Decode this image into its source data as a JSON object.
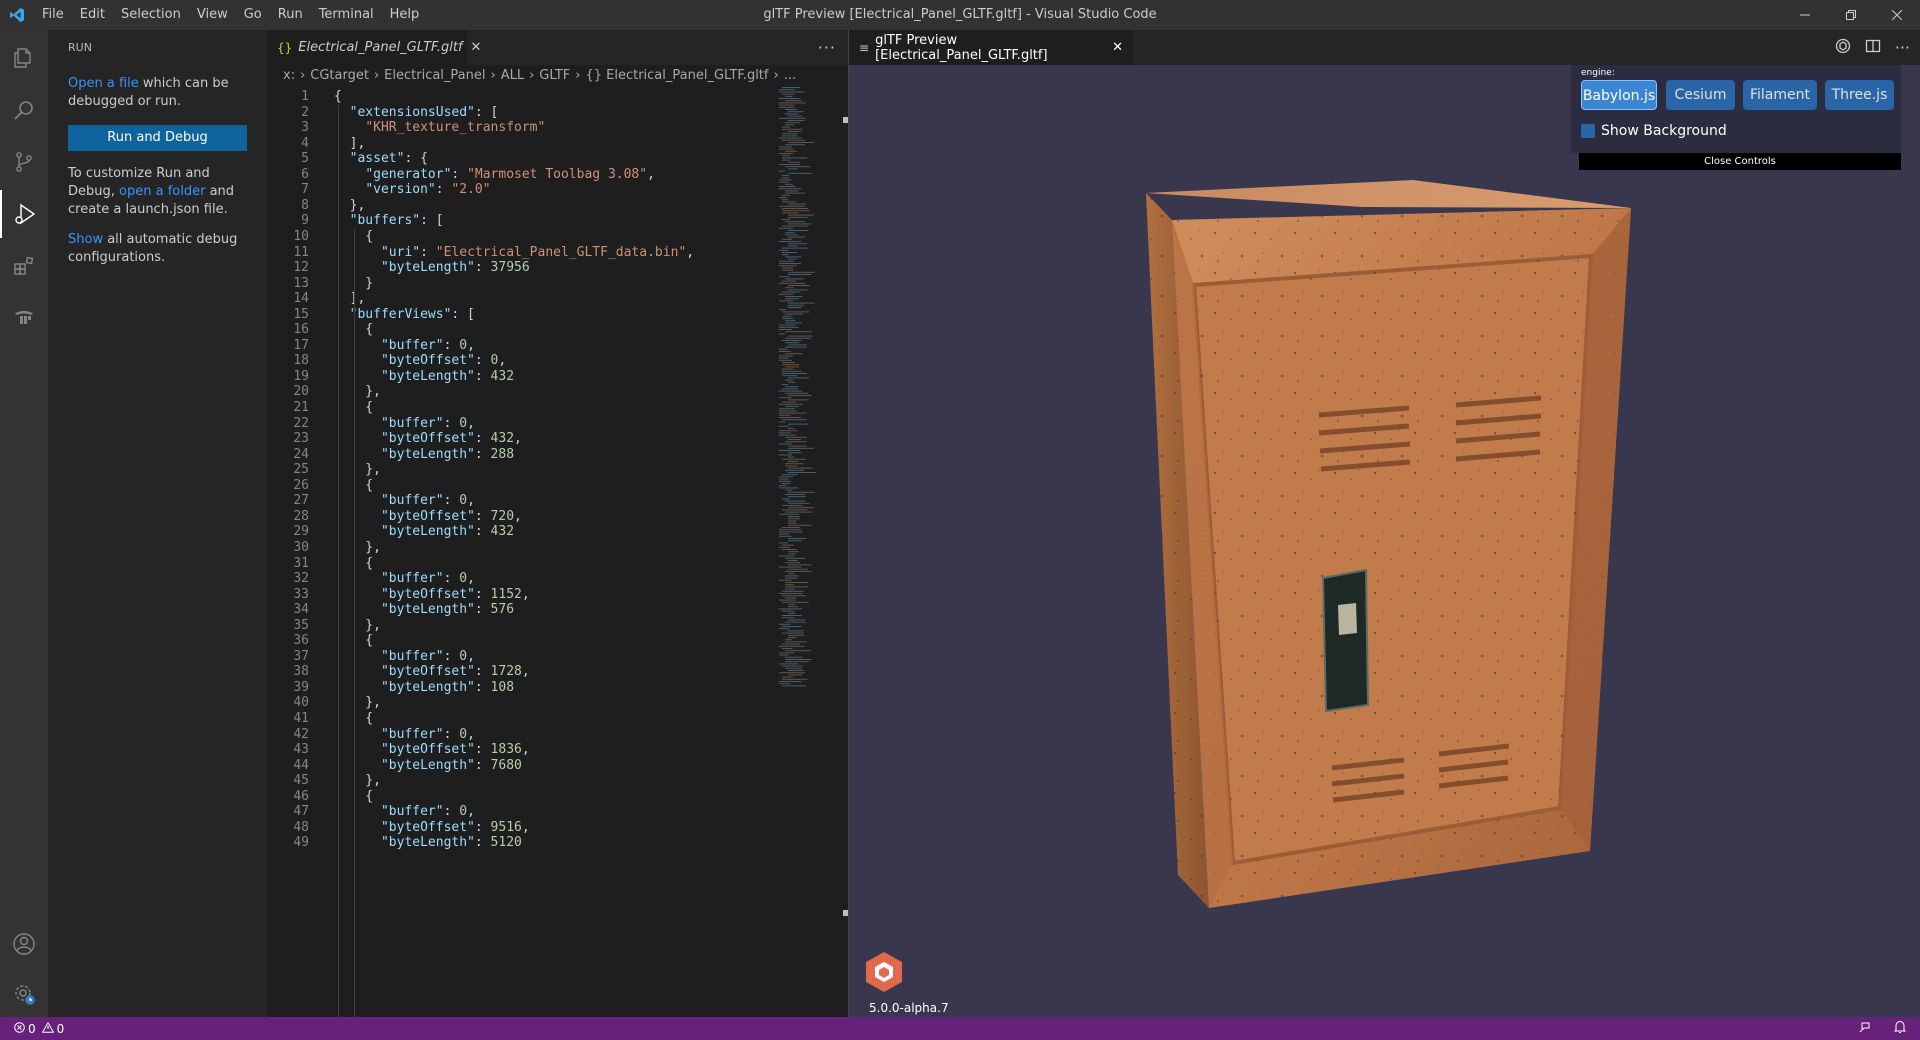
{
  "titlebar": {
    "menu": [
      "File",
      "Edit",
      "Selection",
      "View",
      "Go",
      "Run",
      "Terminal",
      "Help"
    ],
    "window_title": "glTF Preview [Electrical_Panel_GLTF.gltf] - Visual Studio Code"
  },
  "sidebar": {
    "title": "RUN",
    "open_file_link": "Open a file",
    "open_file_rest": " which can be debugged or run.",
    "run_button": "Run and Debug",
    "customize_pre": "To customize Run and Debug, ",
    "open_folder_link": "open a folder",
    "customize_post": " and create a launch.json file.",
    "show_link": "Show",
    "show_rest": " all automatic debug configurations."
  },
  "editor1": {
    "tab_label": "Electrical_Panel_GLTF.gltf",
    "tab_icon": "{}",
    "breadcrumbs": [
      "x:",
      "CGtarget",
      "Electrical_Panel",
      "ALL",
      "GLTF",
      "{} Electrical_Panel_GLTF.gltf",
      "..."
    ],
    "code_lines": [
      {
        "n": "1",
        "t": "{"
      },
      {
        "n": "2",
        "t": "  \"extensionsUsed\": ["
      },
      {
        "n": "3",
        "t": "    \"KHR_texture_transform\""
      },
      {
        "n": "4",
        "t": "  ],"
      },
      {
        "n": "5",
        "t": "  \"asset\": {"
      },
      {
        "n": "6",
        "t": "    \"generator\": \"Marmoset Toolbag 3.08\","
      },
      {
        "n": "7",
        "t": "    \"version\": \"2.0\""
      },
      {
        "n": "8",
        "t": "  },"
      },
      {
        "n": "9",
        "t": "  \"buffers\": ["
      },
      {
        "n": "10",
        "t": "    {"
      },
      {
        "n": "11",
        "t": "      \"uri\": \"Electrical_Panel_GLTF_data.bin\","
      },
      {
        "n": "12",
        "t": "      \"byteLength\": 37956"
      },
      {
        "n": "13",
        "t": "    }"
      },
      {
        "n": "14",
        "t": "  ],"
      },
      {
        "n": "15",
        "t": "  \"bufferViews\": ["
      },
      {
        "n": "16",
        "t": "    {"
      },
      {
        "n": "17",
        "t": "      \"buffer\": 0,"
      },
      {
        "n": "18",
        "t": "      \"byteOffset\": 0,"
      },
      {
        "n": "19",
        "t": "      \"byteLength\": 432"
      },
      {
        "n": "20",
        "t": "    },"
      },
      {
        "n": "21",
        "t": "    {"
      },
      {
        "n": "22",
        "t": "      \"buffer\": 0,"
      },
      {
        "n": "23",
        "t": "      \"byteOffset\": 432,"
      },
      {
        "n": "24",
        "t": "      \"byteLength\": 288"
      },
      {
        "n": "25",
        "t": "    },"
      },
      {
        "n": "26",
        "t": "    {"
      },
      {
        "n": "27",
        "t": "      \"buffer\": 0,"
      },
      {
        "n": "28",
        "t": "      \"byteOffset\": 720,"
      },
      {
        "n": "29",
        "t": "      \"byteLength\": 432"
      },
      {
        "n": "30",
        "t": "    },"
      },
      {
        "n": "31",
        "t": "    {"
      },
      {
        "n": "32",
        "t": "      \"buffer\": 0,"
      },
      {
        "n": "33",
        "t": "      \"byteOffset\": 1152,"
      },
      {
        "n": "34",
        "t": "      \"byteLength\": 576"
      },
      {
        "n": "35",
        "t": "    },"
      },
      {
        "n": "36",
        "t": "    {"
      },
      {
        "n": "37",
        "t": "      \"buffer\": 0,"
      },
      {
        "n": "38",
        "t": "      \"byteOffset\": 1728,"
      },
      {
        "n": "39",
        "t": "      \"byteLength\": 108"
      },
      {
        "n": "40",
        "t": "    },"
      },
      {
        "n": "41",
        "t": "    {"
      },
      {
        "n": "42",
        "t": "      \"buffer\": 0,"
      },
      {
        "n": "43",
        "t": "      \"byteOffset\": 1836,"
      },
      {
        "n": "44",
        "t": "      \"byteLength\": 7680"
      },
      {
        "n": "45",
        "t": "    },"
      },
      {
        "n": "46",
        "t": "    {"
      },
      {
        "n": "47",
        "t": "      \"buffer\": 0,"
      },
      {
        "n": "48",
        "t": "      \"byteOffset\": 9516,"
      },
      {
        "n": "49",
        "t": "      \"byteLength\": 5120"
      }
    ]
  },
  "editor2": {
    "tab_label": "glTF Preview [Electrical_Panel_GLTF.gltf]",
    "controls": {
      "engine_label": "engine:",
      "engines": [
        "Babylon.js",
        "Cesium",
        "Filament",
        "Three.js"
      ],
      "selected_engine": "Babylon.js",
      "show_background_label": "Show Background",
      "close_controls_label": "Close Controls"
    },
    "version": "5.0.0-alpha.7"
  },
  "statusbar": {
    "errors": "0",
    "warnings": "0"
  },
  "icons": {
    "activity": [
      "explorer-icon",
      "search-icon",
      "source-control-icon",
      "run-debug-icon",
      "extensions-icon",
      "terraform-icon",
      "account-icon",
      "settings-icon"
    ]
  },
  "colors": {
    "accent": "#0e639c",
    "statusbar": "#68217a",
    "viewer_bg": "#38374e",
    "engine_button": "#2a66a7"
  }
}
